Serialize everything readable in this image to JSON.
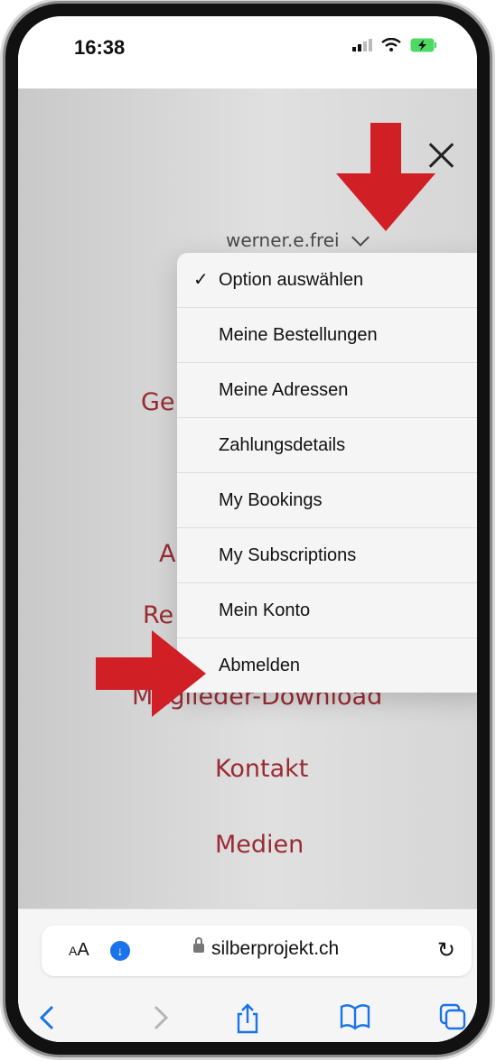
{
  "status_bar": {
    "time": "16:38"
  },
  "header": {
    "username": "werner.e.frei"
  },
  "nav_items": [
    "Ge",
    "A",
    "Re",
    "Mitglieder-Download",
    "Kontakt",
    "Medien"
  ],
  "dropdown": {
    "options": [
      {
        "label": "Option auswählen",
        "selected": true
      },
      {
        "label": "Meine Bestellungen"
      },
      {
        "label": "Meine Adressen"
      },
      {
        "label": "Zahlungsdetails"
      },
      {
        "label": "My Bookings"
      },
      {
        "label": "My Subscriptions"
      },
      {
        "label": "Mein Konto"
      },
      {
        "label": "Abmelden"
      }
    ],
    "checkmark": "✓"
  },
  "browser": {
    "text_size_label": "AA",
    "url": "silberprojekt.ch"
  },
  "colors": {
    "accent": "#9a2b33",
    "arrow": "#d01f25",
    "ios_blue": "#1a73e8"
  },
  "icons": [
    "close-icon",
    "chevron-down-icon",
    "signal-icon",
    "wifi-icon",
    "battery-charging-icon",
    "download-icon",
    "lock-icon",
    "reload-icon",
    "back-icon",
    "forward-icon",
    "share-icon",
    "bookmarks-icon",
    "tabs-icon"
  ]
}
